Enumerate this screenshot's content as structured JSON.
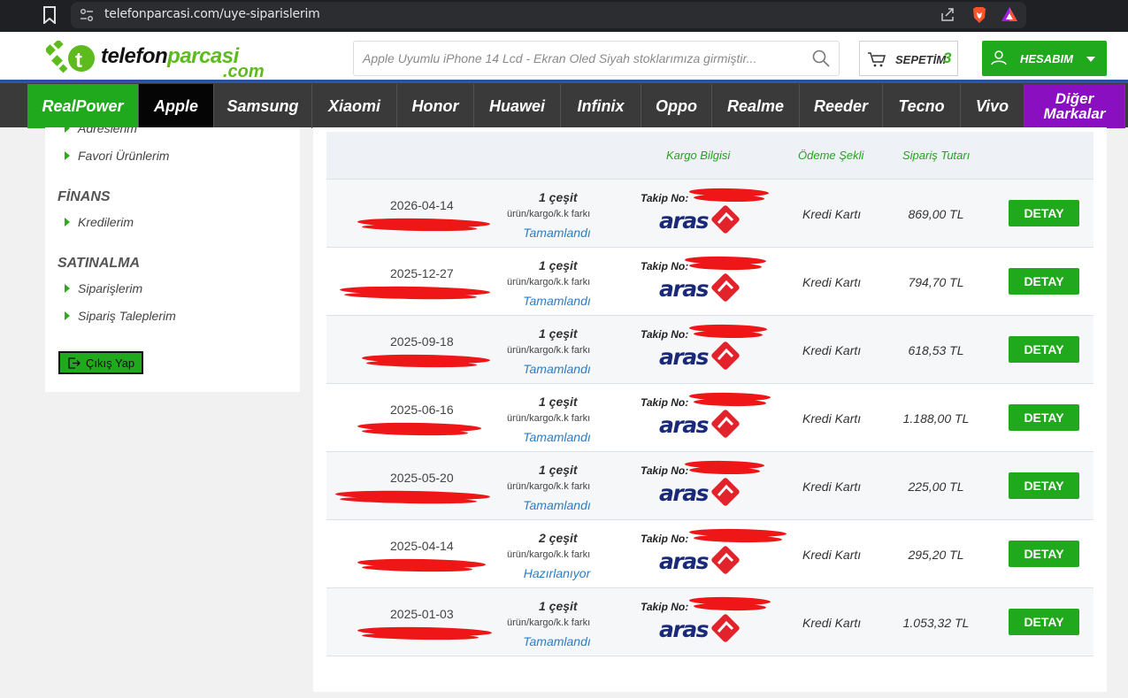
{
  "browser": {
    "url": "telefonparcasi.com/uye-siparislerim"
  },
  "header": {
    "logo_main": "telefonparcasi",
    "logo_sub": ".com",
    "search_placeholder": "Apple Uyumlu iPhone 14 Lcd - Ekran Oled Siyah stoklarımıza girmiştir...",
    "cart_label": "SEPETİM",
    "cart_count": "3",
    "account_label": "HESABIM"
  },
  "nav": [
    "RealPower",
    "Apple",
    "Samsung",
    "Xiaomi",
    "Honor",
    "Huawei",
    "Infinix",
    "Oppo",
    "Realme",
    "Reeder",
    "Tecno",
    "Vivo",
    "Diğer Markalar"
  ],
  "sidebar": {
    "top_partial": "Adreslerim",
    "favori": "Favori Ürünlerim",
    "finans_heading": "FİNANS",
    "kredilerim": "Kredilerim",
    "satinalma_heading": "SATINALMA",
    "siparislerim": "Siparişlerim",
    "talepler": "Sipariş Taleplerim",
    "logout": "Çıkış Yap"
  },
  "table": {
    "headers": {
      "kargo": "Kargo Bilgisi",
      "odeme": "Ödeme Şekli",
      "tutar": "Sipariş Tutarı"
    },
    "fark_label": "ürün/kargo/k.k farkı",
    "takip_label": "Takip No:",
    "carrier": "aras",
    "button_label": "DETAY",
    "rows": [
      {
        "date": "2026-04-14",
        "variety": "1 çeşit",
        "status": "Tamamlandı",
        "payment": "Kredi Kartı",
        "amount": "869,00 TL"
      },
      {
        "date": "2025-12-27",
        "variety": "1 çeşit",
        "status": "Tamamlandı",
        "payment": "Kredi Kartı",
        "amount": "794,70 TL"
      },
      {
        "date": "2025-09-18",
        "variety": "1 çeşit",
        "status": "Tamamlandı",
        "payment": "Kredi Kartı",
        "amount": "618,53 TL"
      },
      {
        "date": "2025-06-16",
        "variety": "1 çeşit",
        "status": "Tamamlandı",
        "payment": "Kredi Kartı",
        "amount": "1.188,00 TL"
      },
      {
        "date": "2025-05-20",
        "variety": "1 çeşit",
        "status": "Tamamlandı",
        "payment": "Kredi Kartı",
        "amount": "225,00 TL"
      },
      {
        "date": "2025-04-14",
        "variety": "2 çeşit",
        "status": "Hazırlanıyor",
        "payment": "Kredi Kartı",
        "amount": "295,20 TL"
      },
      {
        "date": "2025-01-03",
        "variety": "1 çeşit",
        "status": "Tamamlandı",
        "payment": "Kredi Kartı",
        "amount": "1.053,32 TL"
      }
    ]
  },
  "colors": {
    "brand_green": "#21a91e",
    "link_blue": "#2b7dc9",
    "nav_dark": "#3a3a3a",
    "other_purple": "#8a0fc1",
    "redaction": "#ee1616"
  }
}
